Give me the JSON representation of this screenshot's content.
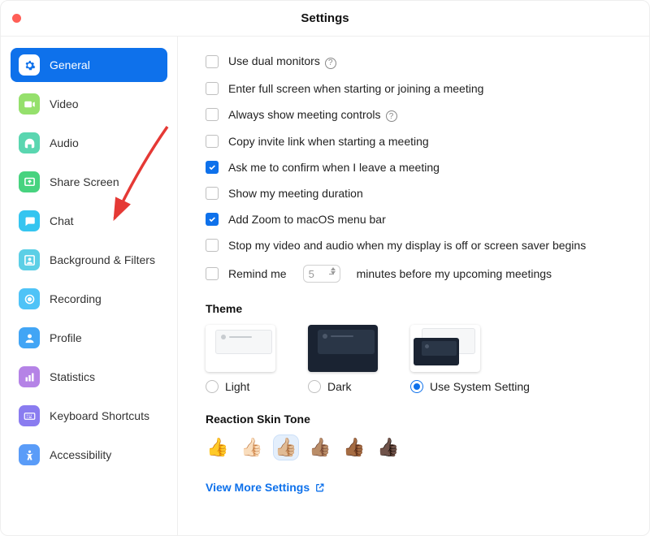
{
  "window": {
    "title": "Settings"
  },
  "sidebar": {
    "items": [
      {
        "id": "general",
        "label": "General",
        "icon": "gear",
        "bg": "#ffffff",
        "fg": "#0e71eb",
        "active": true
      },
      {
        "id": "video",
        "label": "Video",
        "icon": "video",
        "bg": "#95e06c",
        "fg": "#ffffff",
        "active": false
      },
      {
        "id": "audio",
        "label": "Audio",
        "icon": "headphones",
        "bg": "#5ad6b0",
        "fg": "#ffffff",
        "active": false
      },
      {
        "id": "share-screen",
        "label": "Share Screen",
        "icon": "share",
        "bg": "#47d37f",
        "fg": "#ffffff",
        "active": false
      },
      {
        "id": "chat",
        "label": "Chat",
        "icon": "chat",
        "bg": "#35c5f0",
        "fg": "#ffffff",
        "active": false
      },
      {
        "id": "background-filters",
        "label": "Background & Filters",
        "icon": "person-frame",
        "bg": "#5ccfe6",
        "fg": "#ffffff",
        "active": false
      },
      {
        "id": "recording",
        "label": "Recording",
        "icon": "record",
        "bg": "#4fc3f7",
        "fg": "#ffffff",
        "active": false
      },
      {
        "id": "profile",
        "label": "Profile",
        "icon": "profile",
        "bg": "#42a5f5",
        "fg": "#ffffff",
        "active": false
      },
      {
        "id": "statistics",
        "label": "Statistics",
        "icon": "bars",
        "bg": "#b583e6",
        "fg": "#ffffff",
        "active": false
      },
      {
        "id": "keyboard-shortcuts",
        "label": "Keyboard Shortcuts",
        "icon": "keyboard",
        "bg": "#8a7cf0",
        "fg": "#ffffff",
        "active": false
      },
      {
        "id": "accessibility",
        "label": "Accessibility",
        "icon": "accessibility",
        "bg": "#5a9cf8",
        "fg": "#ffffff",
        "active": false
      }
    ]
  },
  "checks": [
    {
      "id": "dual-monitors",
      "label": "Use dual monitors",
      "checked": false,
      "help": true
    },
    {
      "id": "full-screen",
      "label": "Enter full screen when starting or joining a meeting",
      "checked": false,
      "help": false
    },
    {
      "id": "show-controls",
      "label": "Always show meeting controls",
      "checked": false,
      "help": true
    },
    {
      "id": "copy-invite",
      "label": "Copy invite link when starting a meeting",
      "checked": false,
      "help": false
    },
    {
      "id": "confirm-leave",
      "label": "Ask me to confirm when I leave a meeting",
      "checked": true,
      "help": false
    },
    {
      "id": "show-duration",
      "label": "Show my meeting duration",
      "checked": false,
      "help": false
    },
    {
      "id": "menu-bar",
      "label": "Add Zoom to macOS menu bar",
      "checked": true,
      "help": false
    },
    {
      "id": "stop-av",
      "label": "Stop my video and audio when my display is off or screen saver begins",
      "checked": false,
      "help": false
    }
  ],
  "remind": {
    "prefix": "Remind me",
    "value": "5",
    "suffix": "minutes before my upcoming meetings",
    "checked": false
  },
  "theme": {
    "heading": "Theme",
    "options": [
      {
        "id": "light",
        "label": "Light",
        "selected": false
      },
      {
        "id": "dark",
        "label": "Dark",
        "selected": false
      },
      {
        "id": "system",
        "label": "Use System Setting",
        "selected": true
      }
    ]
  },
  "skin": {
    "heading": "Reaction Skin Tone",
    "tones": [
      "👍",
      "👍🏻",
      "👍🏼",
      "👍🏽",
      "👍🏾",
      "👍🏿"
    ],
    "selected_index": 2
  },
  "view_more": "View More Settings",
  "annotation": {
    "target": "background-filters"
  }
}
